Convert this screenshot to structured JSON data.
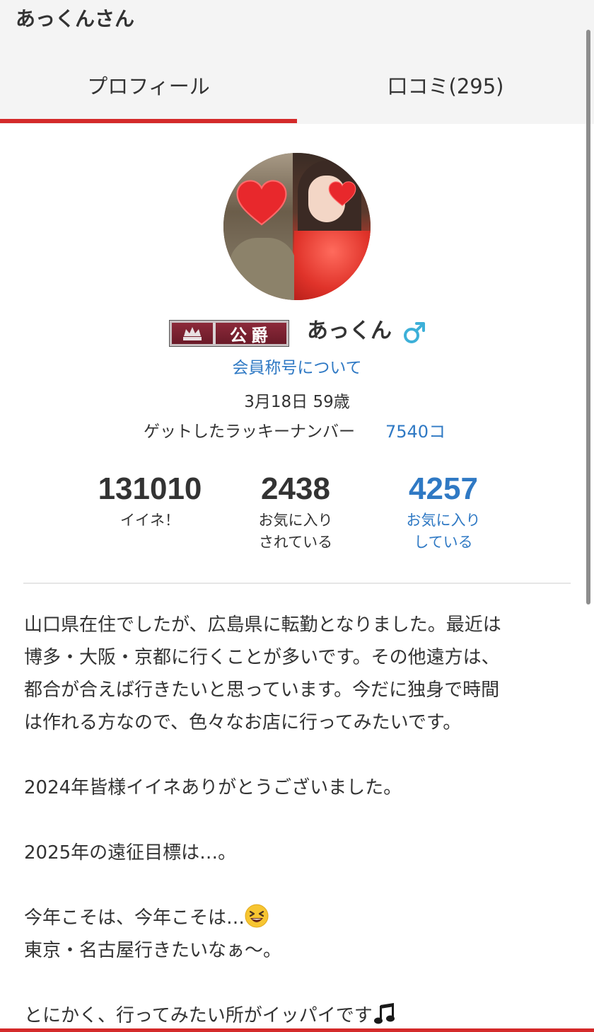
{
  "header": {
    "title": "あっくんさん",
    "tabs": [
      {
        "label": "プロフィール",
        "active": true
      },
      {
        "label": "口コミ(295)",
        "active": false
      }
    ],
    "accent_color": "#d42a2a"
  },
  "profile": {
    "rank_badge": "公爵",
    "name": "あっくん",
    "gender_icon": "male-icon",
    "member_title_link": "会員称号について",
    "birthday": "3月18日 59歳",
    "lucky_number_label": "ゲットしたラッキーナンバー",
    "lucky_number_value": "7540コ"
  },
  "stats": [
    {
      "value": "131010",
      "label_line1": "イイネ！",
      "label_line2": ""
    },
    {
      "value": "2438",
      "label_line1": "お気に入り",
      "label_line2": "されている"
    },
    {
      "value": "4257",
      "label_line1": "お気に入り",
      "label_line2": "している"
    }
  ],
  "bio": {
    "p1_line1": "山口県在住でしたが、広島県に転勤となりました。最近は",
    "p1_line2": "博多・大阪・京都に行くことが多いです。その他遠方は、",
    "p1_line3": "都合が合えば行きたいと思っています。今だに独身で時間",
    "p1_line4": "は作れる方なので、色々なお店に行ってみたいです。",
    "p2": "2024年皆様イイネありがとうございました。",
    "p3": "2025年の遠征目標は…。",
    "p4_line1": "今年こそは、今年こそは…",
    "p4_line2": "東京・名古屋行きたいなぁ～。",
    "p5": "とにかく、行ってみたい所がイッパイです",
    "emoji_1": "laughing-face-emoji",
    "emoji_2": "music-notes-emoji"
  },
  "colors": {
    "link": "#2f79c4",
    "text": "#333333",
    "header_bg": "#f4f4f4"
  }
}
